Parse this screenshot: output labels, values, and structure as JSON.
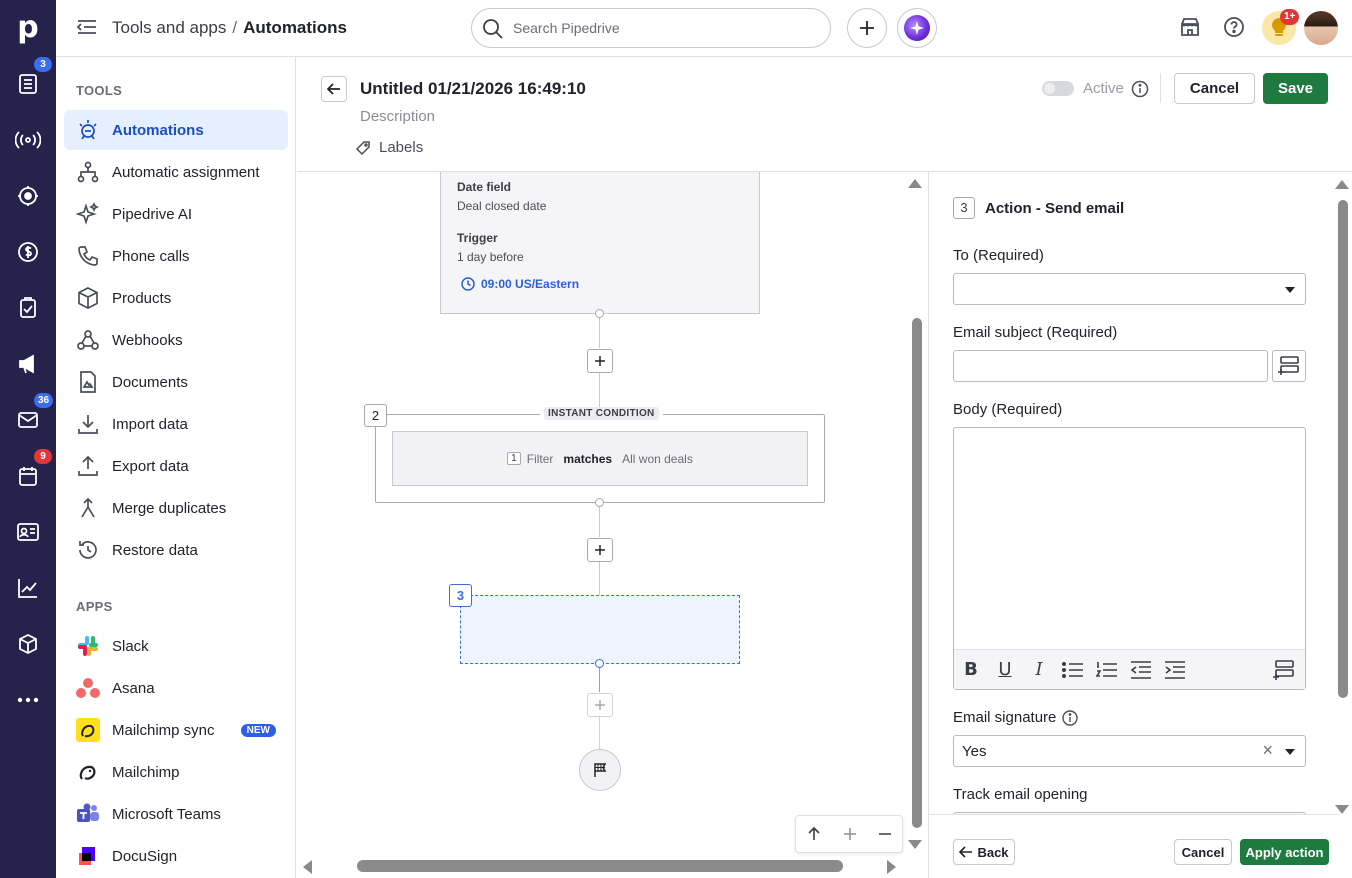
{
  "rail": {
    "logo": "p",
    "items": [
      {
        "icon": "leads-inbox-icon",
        "badge": "3"
      },
      {
        "icon": "broadcast-icon",
        "badge": ""
      },
      {
        "icon": "target-icon",
        "badge": ""
      },
      {
        "icon": "deals-dollar-icon",
        "badge": ""
      },
      {
        "icon": "activities-clipboard-icon",
        "badge": ""
      },
      {
        "icon": "campaigns-megaphone-icon",
        "badge": ""
      },
      {
        "icon": "mail-icon",
        "badge": "36"
      },
      {
        "icon": "calendar-icon",
        "badge": "9"
      },
      {
        "icon": "contacts-card-icon",
        "badge": ""
      },
      {
        "icon": "insights-chart-icon",
        "badge": ""
      },
      {
        "icon": "products-box-icon",
        "badge": ""
      },
      {
        "icon": "more-dots-icon",
        "badge": ""
      }
    ]
  },
  "topbar": {
    "breadcrumb_parent": "Tools and apps",
    "breadcrumb_sep": "/",
    "breadcrumb_current": "Automations",
    "search_placeholder": "Search Pipedrive",
    "notif_badge": "1+"
  },
  "sidebar": {
    "tools_title": "TOOLS",
    "tools": [
      {
        "label": "Automations",
        "active": true
      },
      {
        "label": "Automatic assignment"
      },
      {
        "label": "Pipedrive AI"
      },
      {
        "label": "Phone calls"
      },
      {
        "label": "Products"
      },
      {
        "label": "Webhooks"
      },
      {
        "label": "Documents"
      },
      {
        "label": "Import data"
      },
      {
        "label": "Export data"
      },
      {
        "label": "Merge duplicates"
      },
      {
        "label": "Restore data"
      }
    ],
    "apps_title": "APPS",
    "apps": [
      {
        "label": "Slack"
      },
      {
        "label": "Asana"
      },
      {
        "label": "Mailchimp sync",
        "badge": "NEW"
      },
      {
        "label": "Mailchimp"
      },
      {
        "label": "Microsoft Teams"
      },
      {
        "label": "DocuSign"
      }
    ]
  },
  "header": {
    "title": "Untitled 01/21/2026 16:49:10",
    "description": "Description",
    "labels": "Labels",
    "active_label": "Active",
    "cancel": "Cancel",
    "save": "Save"
  },
  "canvas": {
    "trigger": {
      "date_field_label": "Date field",
      "date_field_value": "Deal closed date",
      "trigger_label": "Trigger",
      "trigger_value": "1 day before",
      "time": "09:00 US/Eastern"
    },
    "condition": {
      "step": "2",
      "tag": "INSTANT CONDITION",
      "filter_num": "1",
      "filter_word": "Filter",
      "filter_op": "matches",
      "filter_value": "All won deals"
    },
    "action_step": "3"
  },
  "panel": {
    "step": "3",
    "title": "Action - Send email",
    "to_label": "To (Required)",
    "to_value": "",
    "subject_label": "Email subject (Required)",
    "subject_value": "",
    "body_label": "Body (Required)",
    "body_tools": [
      "B",
      "U",
      "I"
    ],
    "signature_label": "Email signature",
    "signature_value": "Yes",
    "track_label": "Track email opening",
    "back": "Back",
    "cancel": "Cancel",
    "apply": "Apply action"
  },
  "colors": {
    "rail": "#25224c",
    "primary_green": "#1f7a3f",
    "active_blue": "#1a4ec4"
  }
}
